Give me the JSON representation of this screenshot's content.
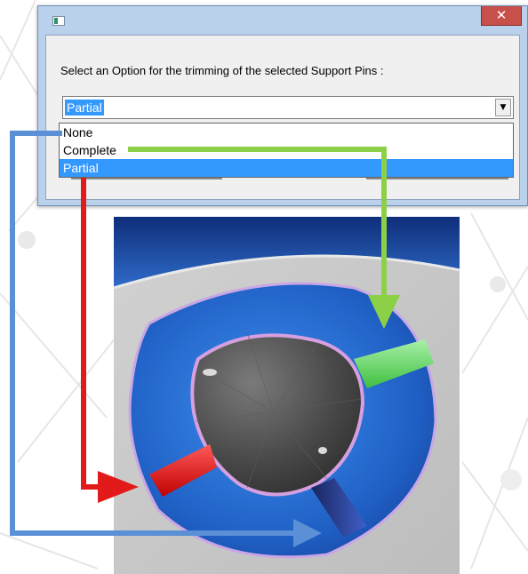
{
  "dialog": {
    "title": "",
    "close_icon": "close-icon",
    "app_icon": "app-icon",
    "prompt": "Select an Option for the trimming of the selected Support Pins :",
    "combo_value": "Partial",
    "combo_arrow_icon": "chevron-down-icon",
    "options": [
      {
        "label": "None"
      },
      {
        "label": "Complete"
      },
      {
        "label": "Partial",
        "selected": true
      }
    ]
  },
  "annotation_colors": {
    "none": "#5b8fd6",
    "complete": "#8cd048",
    "partial": "#e31a1a"
  },
  "viewport": {
    "pin_colors": {
      "complete": "#7ee07e",
      "partial": "#ff1a1a",
      "none": "#2a3a8a"
    }
  }
}
